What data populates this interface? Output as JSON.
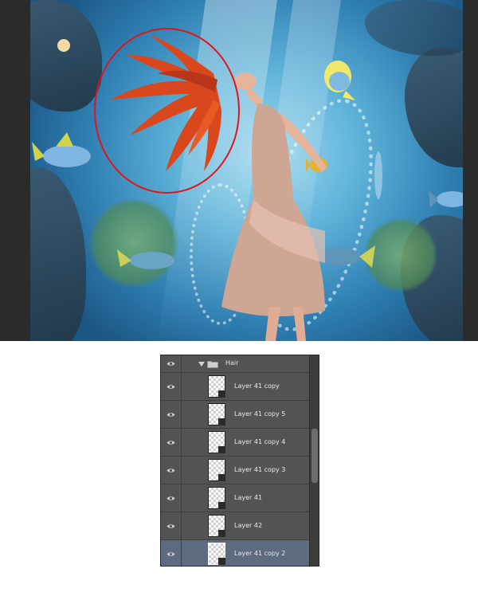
{
  "layers_panel": {
    "group": {
      "name": "Hair",
      "expanded": true,
      "visible": true
    },
    "layers": [
      {
        "name": "Layer 41 copy",
        "visible": true,
        "selected": false
      },
      {
        "name": "Layer 41 copy 5",
        "visible": true,
        "selected": false
      },
      {
        "name": "Layer 41 copy 4",
        "visible": true,
        "selected": false
      },
      {
        "name": "Layer 41 copy 3",
        "visible": true,
        "selected": false
      },
      {
        "name": "Layer 41",
        "visible": true,
        "selected": false
      },
      {
        "name": "Layer 42",
        "visible": true,
        "selected": false
      },
      {
        "name": "Layer 41 copy 2",
        "visible": true,
        "selected": true
      }
    ]
  },
  "icons": {
    "visibility": "eye-icon",
    "group_toggle": "triangle-down-icon",
    "group": "folder-icon"
  },
  "colors": {
    "selection_ellipse": "#e0151b",
    "hair": "#d9481c",
    "panel_bg": "#535353",
    "selected_row": "#5d6b80"
  }
}
